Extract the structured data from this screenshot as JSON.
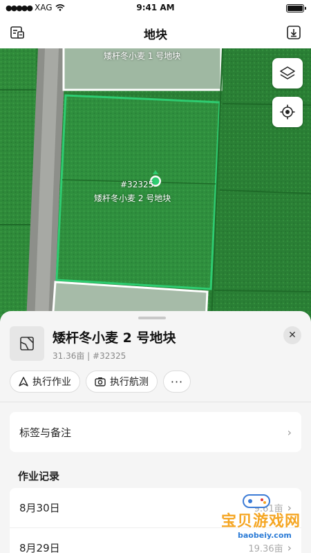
{
  "status_bar": {
    "carrier": "XAG",
    "time": "9:41 AM"
  },
  "nav": {
    "title": "地块",
    "left_icon": "plot-list-icon",
    "right_icon": "download-icon"
  },
  "map": {
    "plot_top_label": "矮杆冬小麦 1 号地块",
    "plot_selected_id": "#32325",
    "plot_selected_label": "矮杆冬小麦 2 号地块",
    "layers_icon": "layers-icon",
    "locate_icon": "locate-icon",
    "highlight_color": "#2ecc71"
  },
  "sheet": {
    "title": "矮杆冬小麦 2 号地块",
    "meta": "31.36亩 | #32325",
    "actions": [
      {
        "label": "执行作业",
        "icon": "navigate-icon"
      },
      {
        "label": "执行航测",
        "icon": "camera-icon"
      }
    ],
    "more_label": "···",
    "tags_label": "标签与备注",
    "records_title": "作业记录",
    "records": [
      {
        "date": "8月30日",
        "area": "9.61亩"
      },
      {
        "date": "8月29日",
        "area": "19.36亩"
      }
    ]
  },
  "watermark": {
    "text": "宝贝游戏网",
    "url": "baobeiy.com"
  }
}
